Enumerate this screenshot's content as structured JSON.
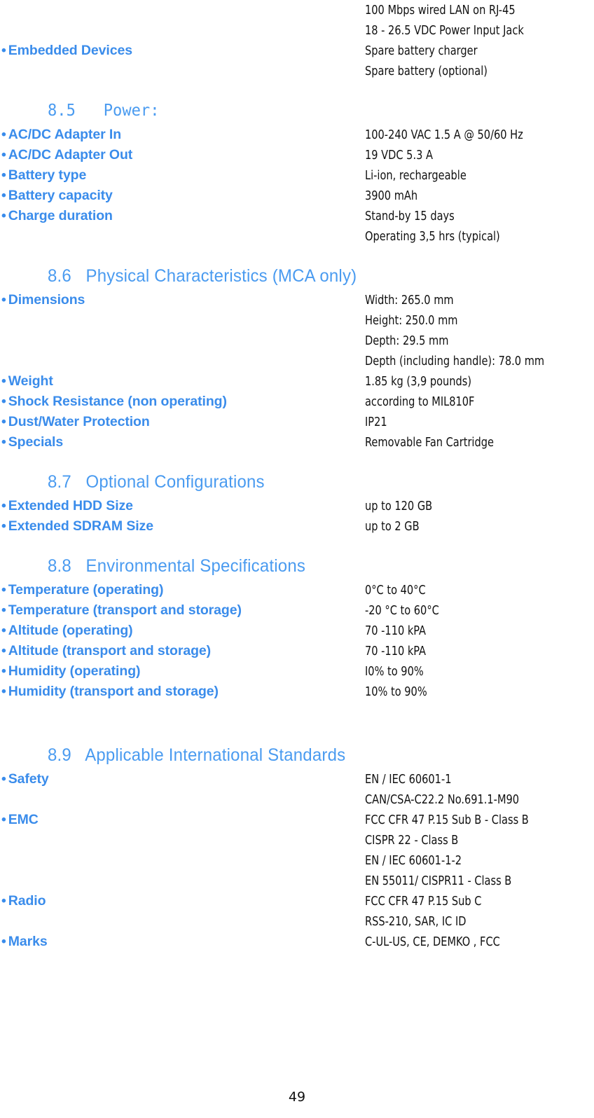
{
  "document": {
    "page_number": "49",
    "bullet_glyph": "•",
    "colors": {
      "label_blue": "#3a8ceb",
      "heading_blue": "#4a9bf0",
      "value_black": "#111111",
      "page_background": "#ffffff"
    }
  },
  "continued_rows": [
    {
      "label": "",
      "values": [
        "100 Mbps wired LAN on RJ-45"
      ]
    },
    {
      "label": "",
      "values": [
        "18 - 26.5 VDC Power Input Jack"
      ]
    },
    {
      "label": "Embedded Devices",
      "values": [
        "Spare battery charger"
      ]
    },
    {
      "label": "",
      "values": [
        "Spare battery (optional)"
      ]
    }
  ],
  "sections": [
    {
      "number": "8.5",
      "title": "Power:",
      "heading_text": "8.5   Power:",
      "mono_heading": true,
      "rows": [
        {
          "label": "AC/DC Adapter In",
          "values": [
            "100-240 VAC 1.5 A @  50/60 Hz"
          ]
        },
        {
          "label": "AC/DC Adapter Out",
          "values": [
            "19 VDC 5.3 A"
          ]
        },
        {
          "label": "Battery type",
          "values": [
            "Li-ion, rechargeable"
          ]
        },
        {
          "label": "Battery capacity",
          "values": [
            "3900 mAh"
          ]
        },
        {
          "label": "Charge duration",
          "values": [
            "Stand-by 15  days",
            "Operating 3,5 hrs (typical)"
          ]
        }
      ]
    },
    {
      "number": "8.6",
      "title": "Physical Characteristics (MCA only)",
      "heading_text": "8.6   Physical Characteristics (MCA only)",
      "mono_heading": false,
      "rows": [
        {
          "label": "Dimensions",
          "values": [
            "Width: 265.0 mm",
            "Height: 250.0 mm",
            "Depth: 29.5 mm",
            "Depth (including handle): 78.0 mm"
          ]
        },
        {
          "label": "Weight",
          "values": [
            "1.85 kg (3,9 pounds)"
          ]
        },
        {
          "label": "Shock Resistance (non operating)",
          "values": [
            "according to MIL810F"
          ]
        },
        {
          "label": "Dust/Water Protection",
          "values": [
            "IP21"
          ]
        },
        {
          "label": "Specials",
          "values": [
            "Removable Fan Cartridge"
          ]
        }
      ]
    },
    {
      "number": "8.7",
      "title": "Optional Configurations",
      "heading_text": "8.7   Optional Configurations",
      "mono_heading": false,
      "rows": [
        {
          "label": "Extended HDD Size",
          "values": [
            "up to 120 GB"
          ]
        },
        {
          "label": "Extended SDRAM Size",
          "values": [
            "up to 2 GB"
          ]
        }
      ]
    },
    {
      "number": "8.8",
      "title": "Environmental Specifications",
      "heading_text": "8.8   Environmental Specifications",
      "mono_heading": false,
      "rows": [
        {
          "label": "Temperature (operating)",
          "values": [
            "0°C to 40°C"
          ]
        },
        {
          "label": "Temperature (transport and storage)",
          "values": [
            "-20 °C to 60°C"
          ]
        },
        {
          "label": "Altitude (operating)",
          "values": [
            "70 -110 kPA"
          ]
        },
        {
          "label": "Altitude (transport and storage)",
          "values": [
            "70 -110 kPA"
          ]
        },
        {
          "label": "Humidity (operating)",
          "values": [
            "I0% to 90%"
          ]
        },
        {
          "label": "Humidity (transport and storage)",
          "values": [
            "10% to 90%"
          ]
        }
      ]
    },
    {
      "number": "8.9",
      "title": "Applicable International Standards",
      "heading_text": "8.9   Applicable International Standards",
      "mono_heading": false,
      "rows": [
        {
          "label": "Safety",
          "values": [
            "EN / IEC 60601-1",
            "CAN/CSA-C22.2 No.691.1-M90"
          ]
        },
        {
          "label": "EMC",
          "values": [
            "FCC CFR 47 P.15 Sub B - Class B",
            "CISPR 22 - Class B",
            "EN / IEC 60601-1-2",
            "EN 55011/ CISPR11 - Class B"
          ]
        },
        {
          "label": "Radio",
          "values": [
            "FCC CFR 47 P.15 Sub C",
            "RSS-210, SAR, IC ID"
          ]
        },
        {
          "label": "Marks",
          "values": [
            "C-UL-US, CE, DEMKO , FCC"
          ]
        }
      ]
    }
  ]
}
